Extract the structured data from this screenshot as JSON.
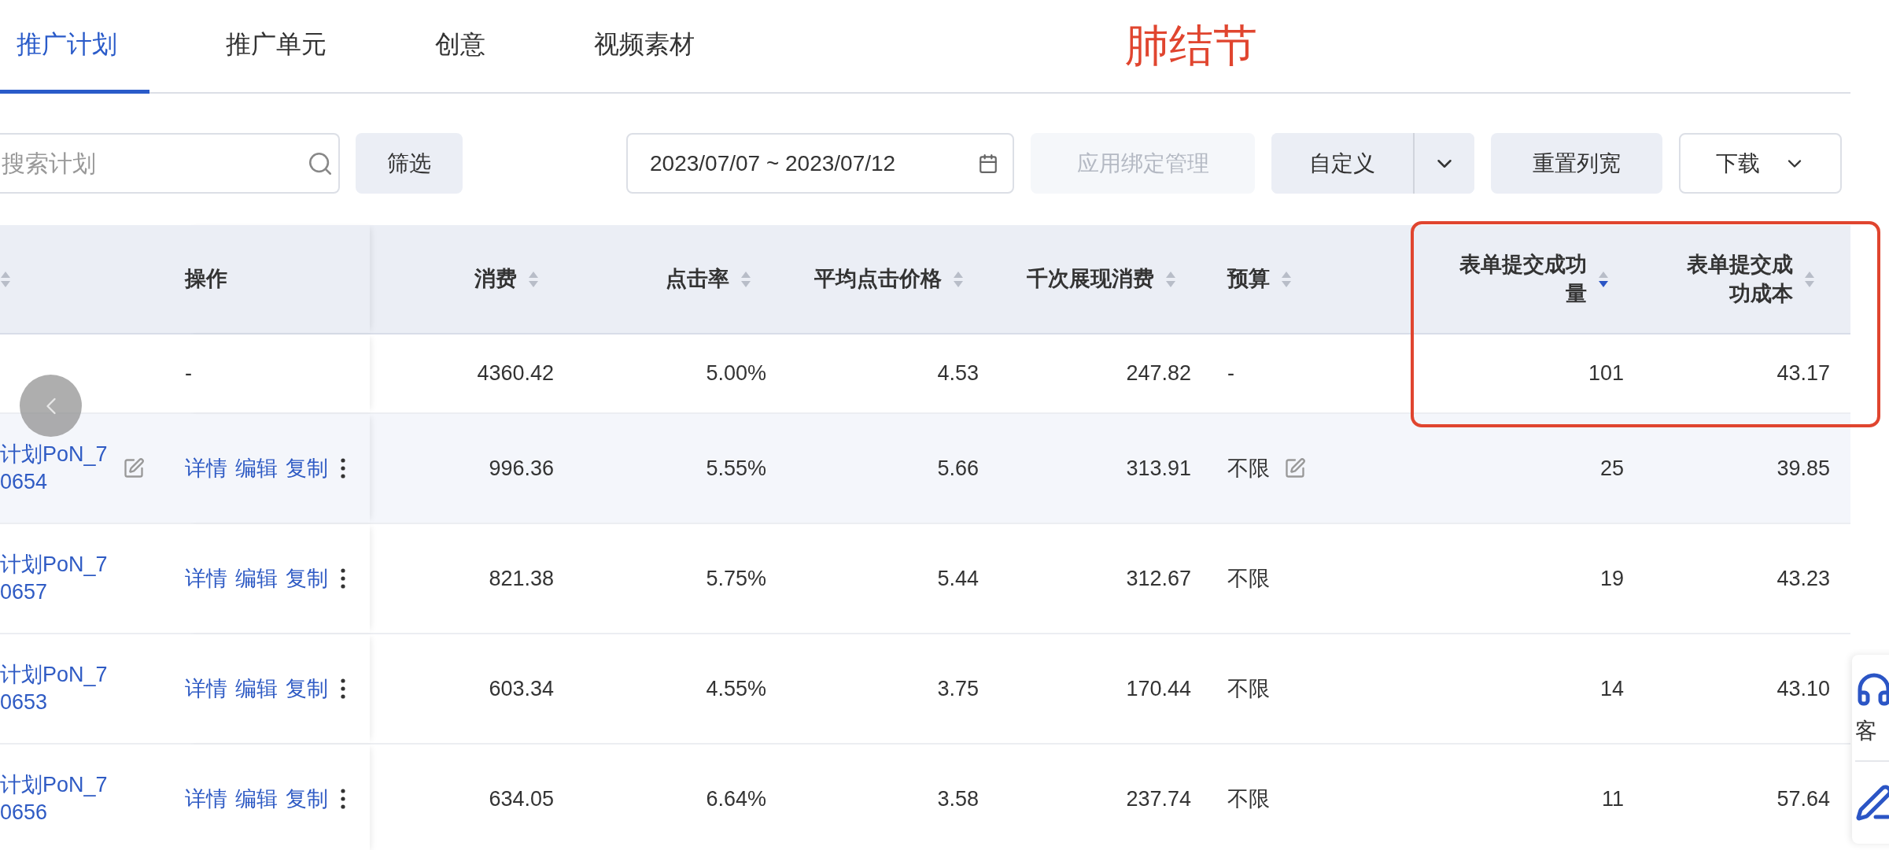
{
  "tabs": [
    {
      "label": "推广计划",
      "selected": true
    },
    {
      "label": "推广单元",
      "selected": false
    },
    {
      "label": "创意",
      "selected": false
    },
    {
      "label": "视频素材",
      "selected": false
    }
  ],
  "annotation": {
    "text": "肺结节",
    "highlight_frame": true
  },
  "toolbar": {
    "search": {
      "placeholder": "搜索计划"
    },
    "filter_button": "筛选",
    "date_range": "2023/07/07 ~ 2023/07/12",
    "buttons": [
      {
        "label": "应用绑定管理",
        "kind": "plain",
        "disabled": true
      },
      {
        "label": "自定义",
        "kind": "split",
        "disabled": false
      },
      {
        "label": "重置列宽",
        "kind": "plain",
        "disabled": false
      },
      {
        "label": "下载",
        "kind": "dropdown",
        "disabled": false
      }
    ]
  },
  "table": {
    "columns": [
      {
        "sortable": true,
        "sorted_desc": false
      },
      {
        "label": "操作",
        "sortable": false
      },
      {
        "label": "消费",
        "sortable": true,
        "sorted_desc": false
      },
      {
        "label": "点击率",
        "sortable": true,
        "sorted_desc": false
      },
      {
        "label": "平均点击价格",
        "sortable": true,
        "sorted_desc": false
      },
      {
        "label": "千次展现消费",
        "sortable": true,
        "sorted_desc": false
      },
      {
        "label": "预算",
        "sortable": true,
        "sorted_desc": false
      },
      {
        "label": "表单提交成功量",
        "sortable": true,
        "sorted_desc": true
      },
      {
        "label": "表单提交成功成本",
        "sortable": true,
        "sorted_desc": false
      }
    ],
    "summary": {
      "actions": "-",
      "values": [
        "4360.42",
        "5.00%",
        "4.53",
        "247.82"
      ],
      "budget": "-",
      "results": [
        "101",
        "43.17"
      ]
    },
    "rows": [
      {
        "name": "计划PoN_70654",
        "hovered": true,
        "actions": [
          "详情",
          "编辑",
          "复制"
        ],
        "values": [
          "996.36",
          "5.55%",
          "5.66",
          "313.91"
        ],
        "budget": "不限",
        "results": [
          "25",
          "39.85"
        ]
      },
      {
        "name": "计划PoN_70657",
        "hovered": false,
        "actions": [
          "详情",
          "编辑",
          "复制"
        ],
        "values": [
          "821.38",
          "5.75%",
          "5.44",
          "312.67"
        ],
        "budget": "不限",
        "results": [
          "19",
          "43.23"
        ]
      },
      {
        "name": "计划PoN_70653",
        "hovered": false,
        "actions": [
          "详情",
          "编辑",
          "复制"
        ],
        "values": [
          "603.34",
          "4.55%",
          "3.75",
          "170.44"
        ],
        "budget": "不限",
        "results": [
          "14",
          "43.10"
        ]
      },
      {
        "name": "计划PoN_70656",
        "hovered": false,
        "actions": [
          "详情",
          "编辑",
          "复制"
        ],
        "values": [
          "634.05",
          "6.64%",
          "3.58",
          "237.74"
        ],
        "budget": "不限",
        "results": [
          "11",
          "57.64"
        ]
      }
    ]
  },
  "side_widget": {
    "label": "客"
  }
}
